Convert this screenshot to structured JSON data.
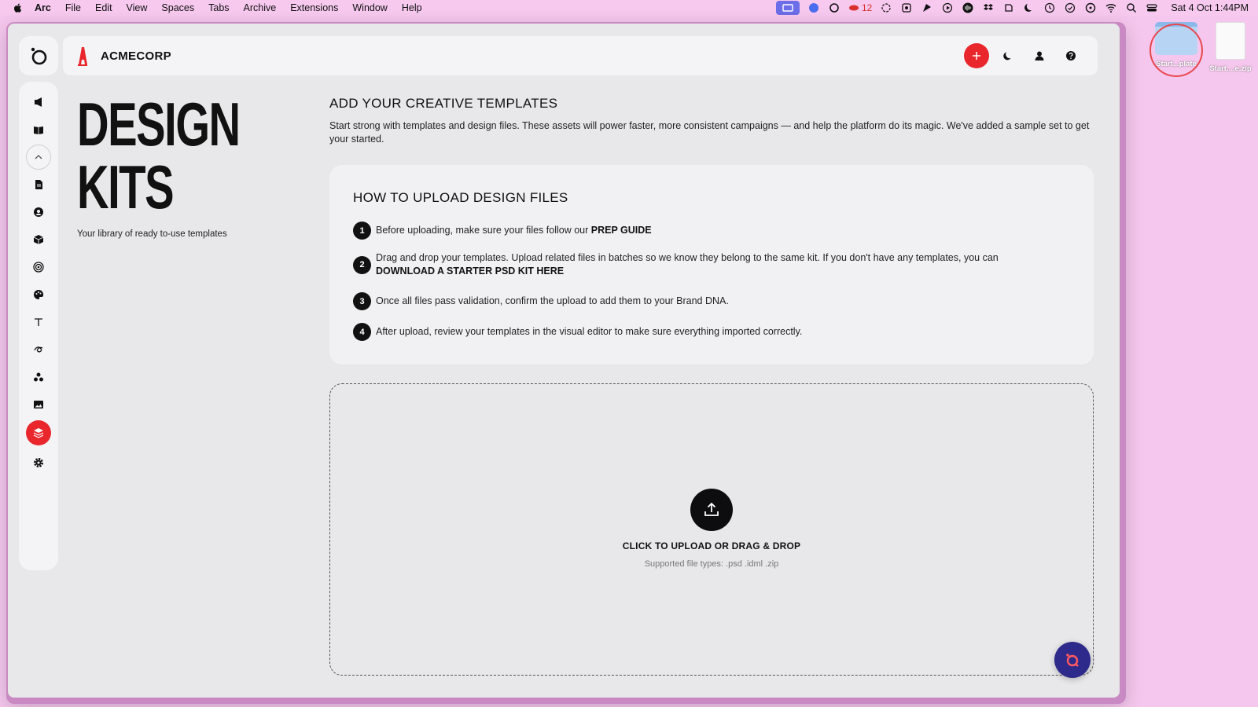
{
  "menubar": {
    "app_name": "Arc",
    "items": [
      "File",
      "Edit",
      "View",
      "Spaces",
      "Tabs",
      "Archive",
      "Extensions",
      "Window",
      "Help"
    ],
    "tray_badge_count": "12",
    "clock": "Sat 4 Oct  1:44PM"
  },
  "header": {
    "brand_name": "ACMECORP",
    "brand_color": "#e8262c"
  },
  "page": {
    "title": "DESIGN KITS",
    "subtitle": "Your library of ready to-use templates"
  },
  "intro": {
    "title": "ADD YOUR CREATIVE TEMPLATES",
    "description": "Start strong with templates and design files. These assets will power faster, more consistent campaigns — and help the platform do its magic. We've added a sample set to get your started."
  },
  "howto": {
    "title": "HOW TO UPLOAD DESIGN FILES",
    "steps": [
      {
        "num": "1",
        "text": "Before uploading, make sure your files follow our ",
        "link": "PREP GUIDE"
      },
      {
        "num": "2",
        "text": "Drag and drop your templates. Upload related files in batches so we know they belong to the same kit. If you don't have any templates, you can ",
        "link": "DOWNLOAD A STARTER PSD KIT HERE"
      },
      {
        "num": "3",
        "text": "Once all files pass validation, confirm the upload to add them to your Brand DNA.",
        "link": ""
      },
      {
        "num": "4",
        "text": "After upload, review your templates in the visual editor to make sure everything imported correctly.",
        "link": ""
      }
    ]
  },
  "upload": {
    "label": "CLICK TO UPLOAD OR DRAG & DROP",
    "types": "Supported file types: .psd .idml .zip"
  },
  "desktop": {
    "items": [
      {
        "label": "Start...plate"
      },
      {
        "label": "Start....e.zip"
      }
    ]
  },
  "colors": {
    "accent": "#e8262c",
    "chat": "#2d2a8c",
    "desktop_bg": "#f6c7ee"
  }
}
